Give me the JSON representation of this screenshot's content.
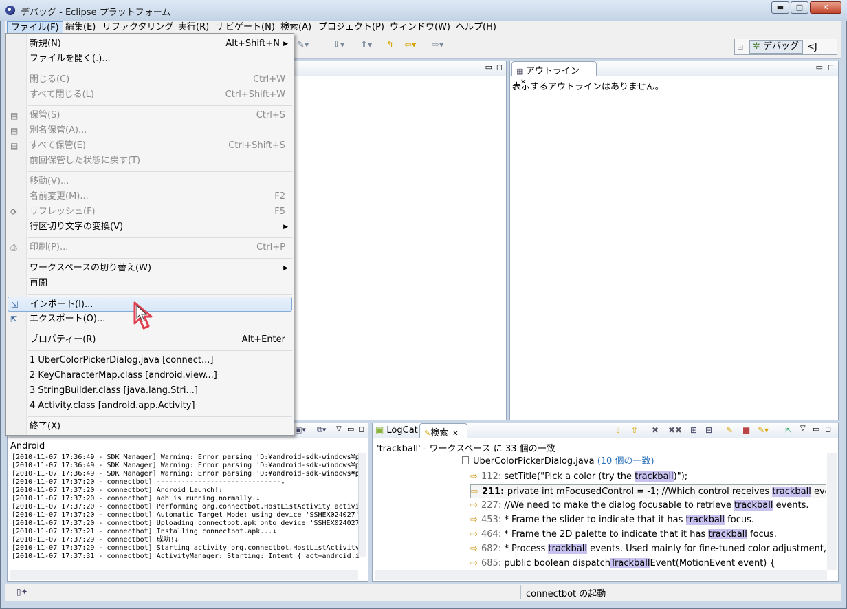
{
  "window": {
    "title": "デバッグ - Eclipse プラットフォーム",
    "min": "▬",
    "max": "□",
    "close": "✕"
  },
  "menubar": [
    "ファイル(F)",
    "編集(E)",
    "リファクタリング",
    "実行(R)",
    "ナビゲート(N)",
    "検索(A)",
    "プロジェクト(P)",
    "ウィンドウ(W)",
    "ヘルプ(H)"
  ],
  "perspective": {
    "label": "デバッグ",
    "next": "<J"
  },
  "file_menu": {
    "new": {
      "label": "新規(N)",
      "accel": "Alt+Shift+N"
    },
    "open_file": {
      "label": "ファイルを開く(.)..."
    },
    "close": {
      "label": "閉じる(C)",
      "accel": "Ctrl+W"
    },
    "close_all": {
      "label": "すべて閉じる(L)",
      "accel": "Ctrl+Shift+W"
    },
    "save": {
      "label": "保管(S)",
      "accel": "Ctrl+S"
    },
    "save_as": {
      "label": "別名保管(A)..."
    },
    "save_all": {
      "label": "すべて保管(E)",
      "accel": "Ctrl+Shift+S"
    },
    "revert": {
      "label": "前回保管した状態に戻す(T)"
    },
    "move": {
      "label": "移動(V)..."
    },
    "rename": {
      "label": "名前変更(M)...",
      "accel": "F2"
    },
    "refresh": {
      "label": "リフレッシュ(F)",
      "accel": "F5"
    },
    "convert_line": {
      "label": "行区切り文字の変換(V)"
    },
    "print": {
      "label": "印刷(P)...",
      "accel": "Ctrl+P"
    },
    "switch_ws": {
      "label": "ワークスペースの切り替え(W)"
    },
    "restart": {
      "label": "再開"
    },
    "import": {
      "label": "インポート(I)..."
    },
    "export": {
      "label": "エクスポート(O)..."
    },
    "properties": {
      "label": "プロパティー(R)",
      "accel": "Alt+Enter"
    },
    "recent": [
      "1 UberColorPickerDialog.java  [connect...]",
      "2 KeyCharacterMap.class  [android.view...]",
      "3 StringBuilder.class  [java.lang.Stri...]",
      "4 Activity.class  [android.app.Activity]"
    ],
    "exit": {
      "label": "終了(X)"
    }
  },
  "outline": {
    "tab": "アウトライン",
    "message": "表示するアウトラインはありません。"
  },
  "console": {
    "title": "Android",
    "lines": [
      "[2010-11-07 17:36:49 - SDK Manager] Warning: Error parsing 'D:¥android-sdk-windows¥p",
      "[2010-11-07 17:36:49 - SDK Manager] Warning: Error parsing 'D:¥android-sdk-windows¥p",
      "[2010-11-07 17:36:49 - SDK Manager] Warning: Error parsing 'D:¥android-sdk-windows¥p",
      "[2010-11-07 17:37:20 - connectbot] ------------------------------↓",
      "[2010-11-07 17:37:20 - connectbot] Android Launch!↓",
      "[2010-11-07 17:37:20 - connectbot] adb is running normally.↓",
      "[2010-11-07 17:37:20 - connectbot] Performing org.connectbot.HostListActivity activi",
      "[2010-11-07 17:37:20 - connectbot] Automatic Target Mode: using device 'SSHEX024027'",
      "[2010-11-07 17:37:20 - connectbot] Uploading connectbot.apk onto device 'SSHEX024027",
      "[2010-11-07 17:37:21 - connectbot] Installing connectbot.apk...↓",
      "[2010-11-07 17:37:29 - connectbot] 成功!↓",
      "[2010-11-07 17:37:29 - connectbot] Starting activity org.connectbot.HostListActivity",
      "[2010-11-07 17:37:31 - connectbot] ActivityManager: Starting: Intent { act=android.i"
    ]
  },
  "search": {
    "tab_logcat": "LogCat",
    "tab_search": "検索",
    "summary": "'trackball' - ワークスペース に 33 個の一致",
    "file": "UberColorPickerDialog.java",
    "file_count": "(10 個の一致)",
    "matches": [
      {
        "line": "112:",
        "pre": "setTitle(\"Pick a color (try the ",
        "hit": "trackball",
        "post": ")\");"
      },
      {
        "line": "211:",
        "pre": "private int mFocusedControl = -1; //Which control receives ",
        "hit": "trackball",
        "post": " events."
      },
      {
        "line": "227:",
        "pre": "//We need to make the dialog focusable to retrieve ",
        "hit": "trackball",
        "post": " events."
      },
      {
        "line": "453:",
        "pre": "* Frame the slider to indicate that it has ",
        "hit": "trackball",
        "post": " focus."
      },
      {
        "line": "464:",
        "pre": "* Frame the 2D palette to indicate that it has ",
        "hit": "trackball",
        "post": " focus."
      },
      {
        "line": "682:",
        "pre": "* Process ",
        "hit": "trackball",
        "post": " events.  Used mainly for fine-tuned color adjustment, or alte"
      },
      {
        "line": "685:",
        "pre": "public boolean dispatch",
        "hit": "Trackball",
        "post": "Event(MotionEvent event) {"
      }
    ]
  },
  "status": {
    "text": "connectbot の起動"
  }
}
